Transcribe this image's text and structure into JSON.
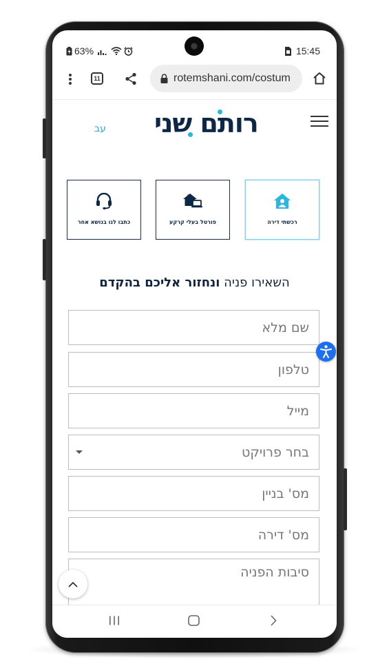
{
  "status_bar": {
    "battery": "63%",
    "time": "15:45"
  },
  "browser": {
    "tab_count": "11",
    "url": "rotemshani.com/costum"
  },
  "site_header": {
    "logo_text": "רותם שני",
    "language_link": "עב"
  },
  "service_cards": [
    {
      "label": "רכשתי דירה",
      "icon": "house-person-icon",
      "active": true
    },
    {
      "label": "פורטל בעלי קרקע",
      "icon": "house-laptop-icon",
      "active": false
    },
    {
      "label": "כתבו לנו בנושא אחר",
      "icon": "headset-icon",
      "active": false
    }
  ],
  "form": {
    "title_regular": "השאירו פניה",
    "title_bold": "ונחזור אליכם בהקדם",
    "fields": {
      "full_name": "שם מלא",
      "phone": "טלפון",
      "email": "מייל",
      "project": "בחר פרויקט",
      "building": "מס' בניין",
      "apartment": "מס' דירה",
      "reason": "סיבות הפניה"
    }
  },
  "colors": {
    "brand_navy": "#0d2847",
    "accent_cyan": "#29b6e0",
    "accessibility_blue": "#1d6ff2"
  }
}
